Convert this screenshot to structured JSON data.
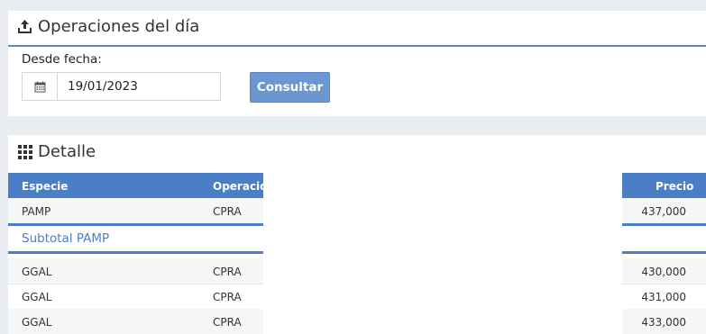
{
  "ops_panel": {
    "title": "Operaciones del día",
    "icon": "upload-tray-icon",
    "desde_label": "Desde fecha:",
    "date_value": "19/01/2023",
    "calendar_icon": "calendar-icon",
    "consultar_label": "Consultar"
  },
  "detail_panel": {
    "title": "Detalle",
    "icon": "grid-icon",
    "columns": {
      "especie": "Especie",
      "operacion": "Operación",
      "precio": "Precio"
    },
    "rows": [
      {
        "especie": "PAMP",
        "operacion": "CPRA",
        "precio": "437,000"
      },
      {
        "especie": "GGAL",
        "operacion": "CPRA",
        "precio": "430,000"
      },
      {
        "especie": "GGAL",
        "operacion": "CPRA",
        "precio": "431,000"
      },
      {
        "especie": "GGAL",
        "operacion": "CPRA",
        "precio": "433,000"
      }
    ],
    "subtotal_label": "Subtotal PAMP"
  },
  "colors": {
    "accent": "#4a7fc8",
    "button": "#6a97d2",
    "background": "#e9edf1"
  }
}
